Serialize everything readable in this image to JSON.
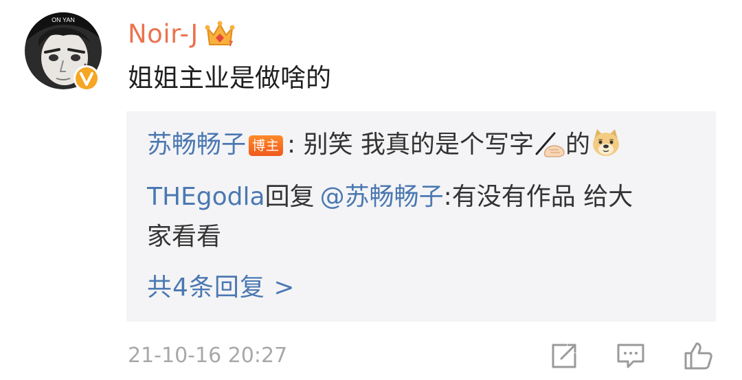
{
  "comment": {
    "username": "Noir-J",
    "text": "姐姐主业是做啥的",
    "timestamp": "21-10-16 20:27",
    "avatar_caption": "ON YAN"
  },
  "replies": [
    {
      "author": "苏畅畅子",
      "badge": "博主",
      "separator": ":",
      "text_before_emoji": " 别笑 我真的是个写字",
      "emoji_1": "writing-hand-emoji",
      "text_after_emoji": "的",
      "emoji_2": "doge-emoji"
    },
    {
      "author": "THEgodla",
      "reply_word": "回复",
      "mention": "@苏畅畅子",
      "separator": ":",
      "text_line_1": "有没有作品 给大",
      "text_line_2": "家看看"
    }
  ],
  "more_replies": "共4条回复 >",
  "actions": {
    "share_icon": "share-icon",
    "comment_icon": "comment-icon",
    "like_icon": "like-icon"
  },
  "colors": {
    "username": "#eb7350",
    "link_blue": "#4b78b1",
    "reply_bg": "#f4f4f6",
    "timestamp": "#a8a8a8",
    "verified_badge": "#f5a623"
  }
}
